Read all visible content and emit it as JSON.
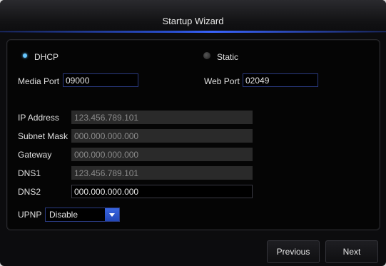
{
  "window": {
    "title": "Startup Wizard"
  },
  "network": {
    "mode_options": [
      {
        "label": "DHCP",
        "selected": true
      },
      {
        "label": "Static",
        "selected": false
      }
    ],
    "media_port": {
      "label": "Media Port",
      "value": "09000"
    },
    "web_port": {
      "label": "Web Port",
      "value": "02049"
    },
    "ip_address": {
      "label": "IP Address",
      "value": "123.456.789.101"
    },
    "subnet_mask": {
      "label": "Subnet Mask",
      "value": "000.000.000.000"
    },
    "gateway": {
      "label": "Gateway",
      "value": "000.000.000.000"
    },
    "dns1": {
      "label": "DNS1",
      "value": "123.456.789.101"
    },
    "dns2": {
      "label": "DNS2",
      "value": "000.000.000.000"
    },
    "upnp": {
      "label": "UPNP",
      "value": "Disable"
    }
  },
  "footer": {
    "previous_label": "Previous",
    "next_label": "Next"
  },
  "colors": {
    "accent": "#3a64ff",
    "radio_selected": "#67c7ff",
    "background": "#0c0c0e"
  },
  "icons": {
    "dropdown": "chevron-down-icon"
  }
}
